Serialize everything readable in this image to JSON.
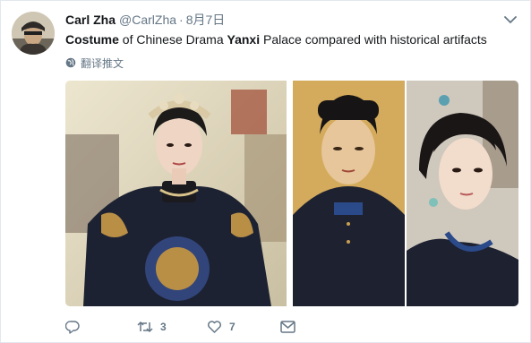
{
  "tweet": {
    "author_name": "Carl Zha",
    "author_handle": "@CarlZha",
    "separator": "·",
    "date": "8月7日",
    "text_parts": {
      "bold1": "Costume",
      "normal1": " of Chinese Drama ",
      "bold2": "Yanxi",
      "normal2": " Palace compared with historical artifacts"
    },
    "translate_label": "翻译推文",
    "retweet_count": "3",
    "like_count": "7"
  },
  "icons": {
    "caret": "chevron-down-icon",
    "translate": "globe-icon",
    "reply": "reply-icon",
    "retweet": "retweet-icon",
    "like": "heart-icon",
    "dm": "envelope-icon"
  },
  "colors": {
    "text": "#14171a",
    "secondary": "#657786",
    "border": "#e1e8ed"
  }
}
